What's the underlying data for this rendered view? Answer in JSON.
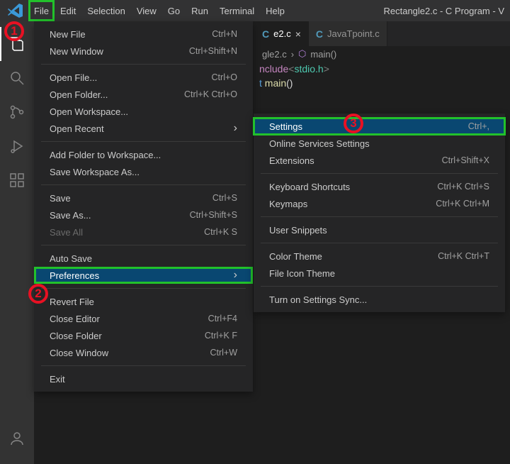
{
  "menubar": {
    "items": [
      "File",
      "Edit",
      "Selection",
      "View",
      "Go",
      "Run",
      "Terminal",
      "Help"
    ],
    "title_right": "Rectangle2.c - C Program - V"
  },
  "tabs": {
    "active": {
      "icon": "C",
      "name": "e2.c"
    },
    "other": {
      "icon": "C",
      "name": "JavaTpoint.c"
    }
  },
  "breadcrumbs": {
    "file": "gle2.c",
    "symbol_icon": "⬡",
    "symbol": "main()"
  },
  "code": {
    "l1_a": "nclude",
    "l1_b": "<",
    "l1_c": "stdio.h",
    "l1_d": ">",
    "l2_a": "t ",
    "l2_b": "main",
    "l2_c": "()"
  },
  "file_menu": {
    "items": [
      {
        "label": "New File",
        "short": "Ctrl+N"
      },
      {
        "label": "New Window",
        "short": "Ctrl+Shift+N"
      },
      {
        "sep": true
      },
      {
        "label": "Open File...",
        "short": "Ctrl+O"
      },
      {
        "label": "Open Folder...",
        "short": "Ctrl+K Ctrl+O"
      },
      {
        "label": "Open Workspace..."
      },
      {
        "label": "Open Recent",
        "chev": true
      },
      {
        "sep": true
      },
      {
        "label": "Add Folder to Workspace..."
      },
      {
        "label": "Save Workspace As..."
      },
      {
        "sep": true
      },
      {
        "label": "Save",
        "short": "Ctrl+S"
      },
      {
        "label": "Save As...",
        "short": "Ctrl+Shift+S"
      },
      {
        "label": "Save All",
        "short": "Ctrl+K S",
        "disabled": true
      },
      {
        "sep": true
      },
      {
        "label": "Auto Save"
      },
      {
        "label": "Preferences",
        "chev": true,
        "highlight": true
      },
      {
        "sep": true
      },
      {
        "label": "Revert File"
      },
      {
        "label": "Close Editor",
        "short": "Ctrl+F4"
      },
      {
        "label": "Close Folder",
        "short": "Ctrl+K F"
      },
      {
        "label": "Close Window",
        "short": "Ctrl+W"
      },
      {
        "sep": true
      },
      {
        "label": "Exit"
      }
    ]
  },
  "pref_submenu": {
    "items": [
      {
        "label": "Settings",
        "short": "Ctrl+,",
        "highlight": true
      },
      {
        "label": "Online Services Settings"
      },
      {
        "label": "Extensions",
        "short": "Ctrl+Shift+X"
      },
      {
        "sep": true
      },
      {
        "label": "Keyboard Shortcuts",
        "short": "Ctrl+K Ctrl+S"
      },
      {
        "label": "Keymaps",
        "short": "Ctrl+K Ctrl+M"
      },
      {
        "sep": true
      },
      {
        "label": "User Snippets"
      },
      {
        "sep": true
      },
      {
        "label": "Color Theme",
        "short": "Ctrl+K Ctrl+T"
      },
      {
        "label": "File Icon Theme"
      },
      {
        "sep": true
      },
      {
        "label": "Turn on Settings Sync..."
      }
    ]
  },
  "annotations": {
    "b1": "1",
    "b2": "2",
    "b3": "3"
  }
}
